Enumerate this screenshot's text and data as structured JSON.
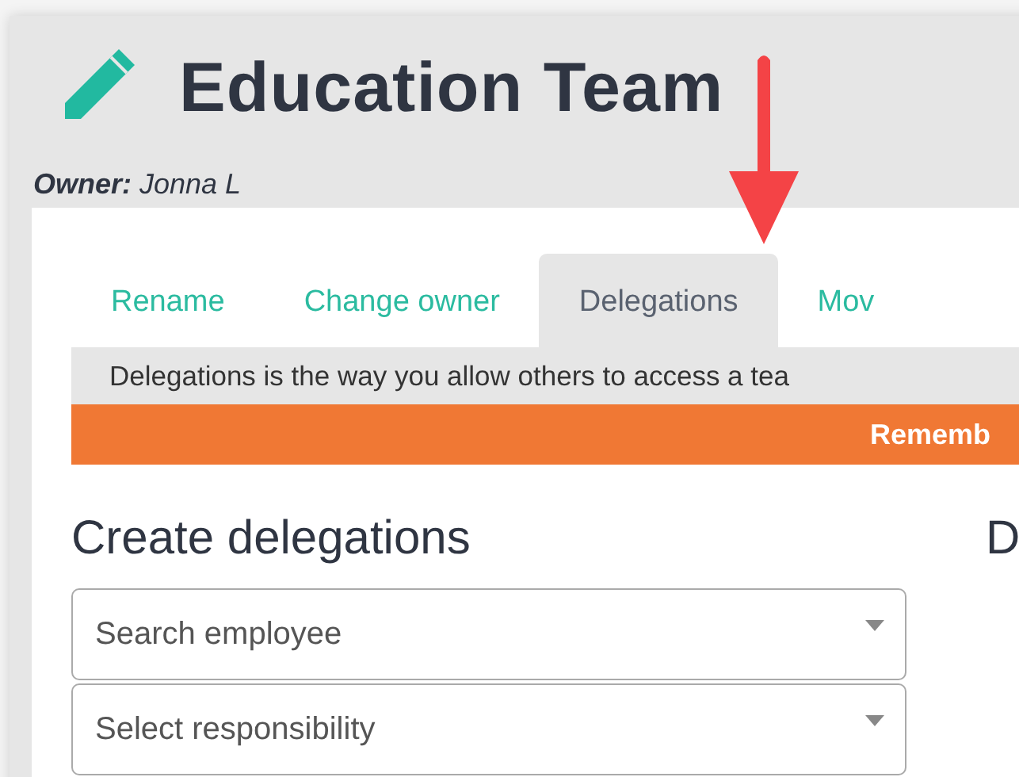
{
  "header": {
    "title": "Education Team",
    "owner_label": "Owner:",
    "owner": "Jonna L"
  },
  "tabs": [
    {
      "label": "Rename",
      "selected": false
    },
    {
      "label": "Change owner",
      "selected": false
    },
    {
      "label": "Delegations",
      "selected": true
    },
    {
      "label": "Mov",
      "selected": false
    }
  ],
  "info_text": "Delegations is the way you allow others to access a tea",
  "notice_text": "Rememb",
  "create_section": {
    "heading": "Create delegations",
    "fields": [
      {
        "placeholder": "Search employee"
      },
      {
        "placeholder": "Select responsibility"
      }
    ]
  },
  "column_2_heading": "D"
}
